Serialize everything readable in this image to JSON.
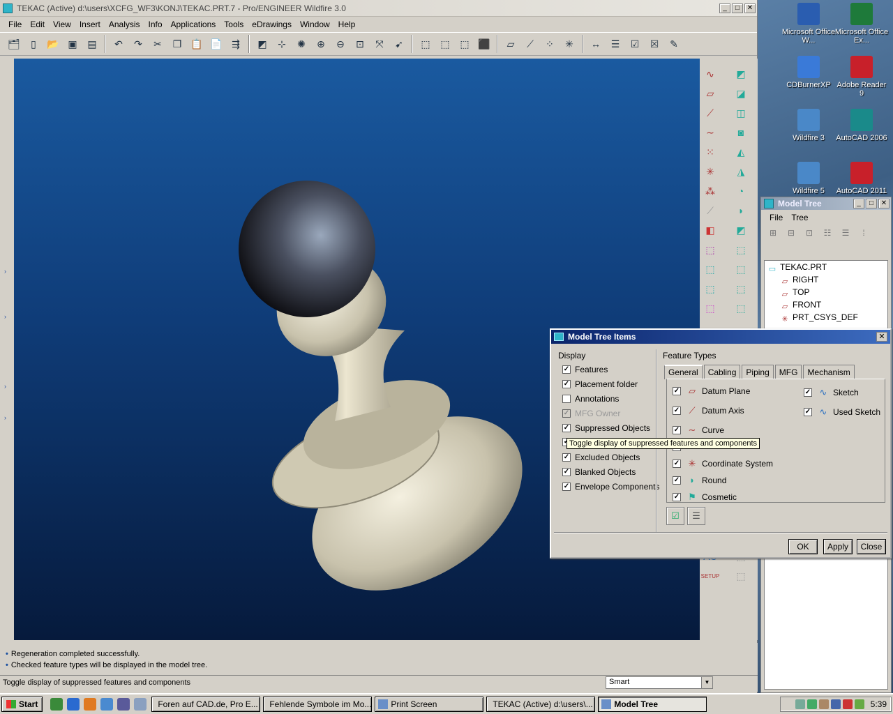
{
  "window": {
    "title": "TEKAC (Active) d:\\users\\XCFG_WF3\\KONJ\\TEKAC.PRT.7 - Pro/ENGINEER Wildfire 3.0"
  },
  "menu": [
    "File",
    "Edit",
    "View",
    "Insert",
    "Analysis",
    "Info",
    "Applications",
    "Tools",
    "eDrawings",
    "Window",
    "Help"
  ],
  "messages": [
    "Regeneration completed successfully.",
    "Checked feature types will be displayed in the model tree."
  ],
  "status": {
    "text": "Toggle display of suppressed features and components",
    "filter": "Smart"
  },
  "right_toolbar": {
    "ac_label": "AC"
  },
  "desktop_icons": [
    {
      "label": "Microsoft Office W...",
      "color": "#2a5db0"
    },
    {
      "label": "Microsoft Office Ex...",
      "color": "#1e7a3a"
    },
    {
      "label": "CDBurnerXP",
      "color": "#3a7ad8"
    },
    {
      "label": "Adobe Reader 9",
      "color": "#c8202a"
    },
    {
      "label": "Wildfire 3",
      "color": "#4a88c8"
    },
    {
      "label": "AutoCAD 2006",
      "color": "#1a8a8a"
    },
    {
      "label": "Wildfire 5",
      "color": "#4a88c8"
    },
    {
      "label": "AutoCAD 2011",
      "color": "#c8202a"
    }
  ],
  "model_tree": {
    "title": "Model Tree",
    "menu": [
      "File",
      "Tree"
    ],
    "items": [
      {
        "label": "TEKAC.PRT",
        "icon": "part-icon"
      },
      {
        "label": "RIGHT",
        "icon": "datum-plane-icon"
      },
      {
        "label": "TOP",
        "icon": "datum-plane-icon"
      },
      {
        "label": "FRONT",
        "icon": "datum-plane-icon"
      },
      {
        "label": "PRT_CSYS_DEF",
        "icon": "coordinate-system-icon"
      }
    ]
  },
  "dialog": {
    "title": "Model Tree Items",
    "display_label": "Display",
    "display_items": [
      {
        "label": "Features",
        "checked": true,
        "disabled": false
      },
      {
        "label": "Placement folder",
        "checked": true,
        "disabled": false
      },
      {
        "label": "Annotations",
        "checked": false,
        "disabled": false
      },
      {
        "label": "MFG Owner",
        "checked": true,
        "disabled": true
      },
      {
        "label": "Suppressed Objects",
        "checked": true,
        "disabled": false
      },
      {
        "label": "",
        "checked": true,
        "disabled": false
      },
      {
        "label": "Excluded Objects",
        "checked": true,
        "disabled": false
      },
      {
        "label": "Blanked Objects",
        "checked": true,
        "disabled": false
      },
      {
        "label": "Envelope Components",
        "checked": true,
        "disabled": false
      }
    ],
    "feature_types_label": "Feature Types",
    "tabs": [
      "General",
      "Cabling",
      "Piping",
      "MFG",
      "Mechanism"
    ],
    "active_tab": "General",
    "features_left": [
      {
        "label": "Datum Plane",
        "checked": true,
        "icon": "datum-plane-icon"
      },
      {
        "label": "Datum Axis",
        "checked": true,
        "icon": "datum-axis-icon"
      },
      {
        "label": "Curve",
        "checked": true,
        "icon": "curve-icon"
      },
      {
        "label": "",
        "checked": true,
        "icon": ""
      },
      {
        "label": "Coordinate System",
        "checked": true,
        "icon": "coordinate-system-icon"
      },
      {
        "label": "Round",
        "checked": true,
        "icon": "round-icon"
      },
      {
        "label": "Cosmetic",
        "checked": true,
        "icon": "cosmetic-icon"
      }
    ],
    "features_right": [
      {
        "label": "Sketch",
        "checked": true,
        "icon": "sketch-icon"
      },
      {
        "label": "Used Sketch",
        "checked": true,
        "icon": "used-sketch-icon"
      }
    ],
    "buttons": {
      "ok": "OK",
      "apply": "Apply",
      "close": "Close"
    },
    "tooltip": "Toggle display of suppressed features and components"
  },
  "taskbar": {
    "start": "Start",
    "tasks": [
      {
        "label": "Foren auf CAD.de, Pro E...",
        "active": false
      },
      {
        "label": "Fehlende Symbole im Mo...",
        "active": false
      },
      {
        "label": "Print Screen",
        "active": false
      },
      {
        "label": "TEKAC (Active) d:\\users\\...",
        "active": false
      },
      {
        "label": "Model Tree",
        "active": true
      }
    ],
    "clock": "5:39"
  }
}
